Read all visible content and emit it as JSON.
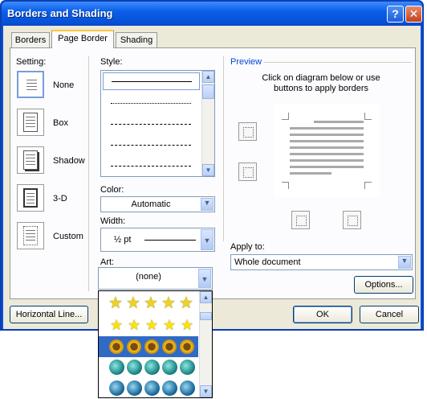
{
  "window": {
    "title": "Borders and Shading",
    "help": "?",
    "close": "✕"
  },
  "tabs": [
    "Borders",
    "Page Border",
    "Shading"
  ],
  "setting": {
    "label": "Setting:",
    "options": [
      "None",
      "Box",
      "Shadow",
      "3-D",
      "Custom"
    ]
  },
  "style": {
    "label": "Style:"
  },
  "color": {
    "label": "Color:",
    "value": "Automatic"
  },
  "width": {
    "label": "Width:",
    "value": "½ pt"
  },
  "art": {
    "label": "Art:",
    "value": "(none)"
  },
  "preview": {
    "label": "Preview",
    "hint_line1": "Click on diagram below or use",
    "hint_line2": "buttons to apply borders"
  },
  "apply_to": {
    "label": "Apply to:",
    "value": "Whole document"
  },
  "buttons": {
    "options": "Options...",
    "horizontal_line": "Horizontal Line...",
    "ok": "OK",
    "cancel": "Cancel"
  },
  "icons": {
    "dropdown": "▼",
    "up": "▲",
    "down": "▼",
    "star": "★"
  },
  "colors": {
    "title_bar": "#0b5fe9",
    "dialog_bg": "#ece9d8",
    "selection": "#316ac5",
    "tab_highlight": "#ffc83c"
  }
}
